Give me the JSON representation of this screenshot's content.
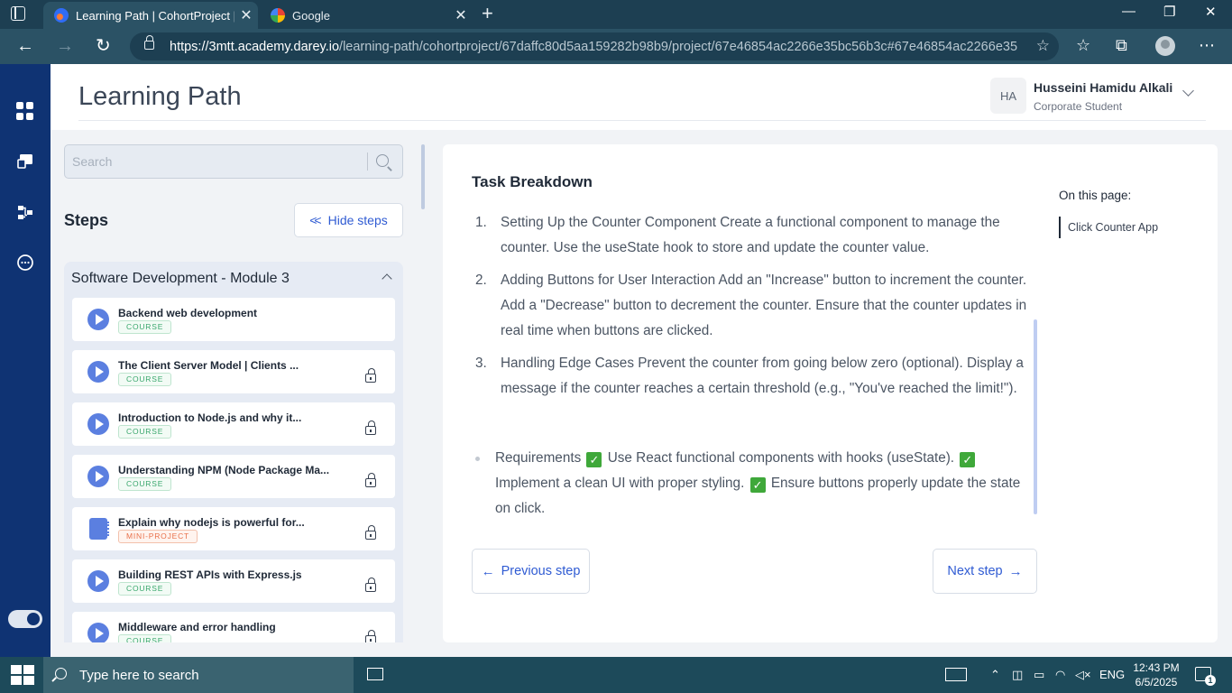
{
  "browser": {
    "tabs": [
      {
        "title": "Learning Path | CohortProject | D",
        "active": true,
        "favicon": "darey-favicon"
      },
      {
        "title": "Google",
        "active": false,
        "favicon": "google-favicon"
      }
    ],
    "new_tab_symbol": "+",
    "close_symbol": "✕",
    "window_controls": {
      "minimize": "—",
      "restore": "❐",
      "close": "✕"
    },
    "url_host": "https://3mtt.academy.darey.io",
    "url_path": "/learning-path/cohortproject/67daffc80d5aa159282b98b9/project/67e46854ac2266e35bc56b3c#67e46854ac2266e35bc...",
    "nav": {
      "back": "←",
      "forward": "→",
      "reload": "↻"
    },
    "toolbar_icons": {
      "favorites_add": "☆",
      "favorites": "☆",
      "collections": "⧉",
      "menu": "⋯"
    }
  },
  "header": {
    "title": "Learning Path",
    "user": {
      "initials": "HA",
      "name": "Husseini Hamidu Alkali",
      "role": "Corporate Student"
    }
  },
  "sidebar": {
    "search_placeholder": "Search",
    "steps_heading": "Steps",
    "hide_steps_label": "Hide steps",
    "module": {
      "title": "Software Development - Module 3",
      "steps": [
        {
          "name": "Backend web development",
          "badge": "COURSE",
          "type": "course",
          "locked": false
        },
        {
          "name": "The Client Server Model | Clients ...",
          "badge": "COURSE",
          "type": "course",
          "locked": true
        },
        {
          "name": "Introduction to Node.js and why it...",
          "badge": "COURSE",
          "type": "course",
          "locked": true
        },
        {
          "name": "Understanding NPM (Node Package Ma...",
          "badge": "COURSE",
          "type": "course",
          "locked": true
        },
        {
          "name": "Explain why nodejs is powerful for...",
          "badge": "MINI-PROJECT",
          "type": "mini",
          "locked": true
        },
        {
          "name": "Building REST APIs with Express.js",
          "badge": "COURSE",
          "type": "course",
          "locked": true
        },
        {
          "name": "Middleware and error handling",
          "badge": "COURSE",
          "type": "course",
          "locked": true
        }
      ]
    }
  },
  "main": {
    "section_title": "Task Breakdown",
    "tasks": [
      {
        "num": "1.",
        "text": "Setting Up the Counter Component Create a functional component to manage the counter. Use the useState hook to store and update the counter value."
      },
      {
        "num": "2.",
        "text": "Adding Buttons for User Interaction Add an \"Increase\" button to increment the counter. Add a \"Decrease\" button to decrement the counter. Ensure that the counter updates in real time when buttons are clicked."
      },
      {
        "num": "3.",
        "text": "Handling Edge Cases Prevent the counter from going below zero (optional). Display a message if the counter reaches a certain threshold (e.g., \"You've reached the limit!\")."
      }
    ],
    "requirements": {
      "intro": "Requirements",
      "check": "✓",
      "items": [
        "Use React functional components with hooks (useState).",
        "Implement a clean UI with proper styling.",
        "Ensure buttons properly update the state on click."
      ]
    },
    "prev_label": "Previous step",
    "next_label": "Next step",
    "toc": {
      "heading": "On this page:",
      "items": [
        "Click Counter App"
      ]
    }
  },
  "taskbar": {
    "search_placeholder": "Type here to search",
    "language": "ENG",
    "time": "12:43 PM",
    "date": "6/5/2025",
    "notification_count": "1"
  },
  "colors": {
    "brand_navy": "#0f3373",
    "link_blue": "#2f5bd3",
    "course_green": "#3aa76d",
    "mini_orange": "#e8704a"
  }
}
